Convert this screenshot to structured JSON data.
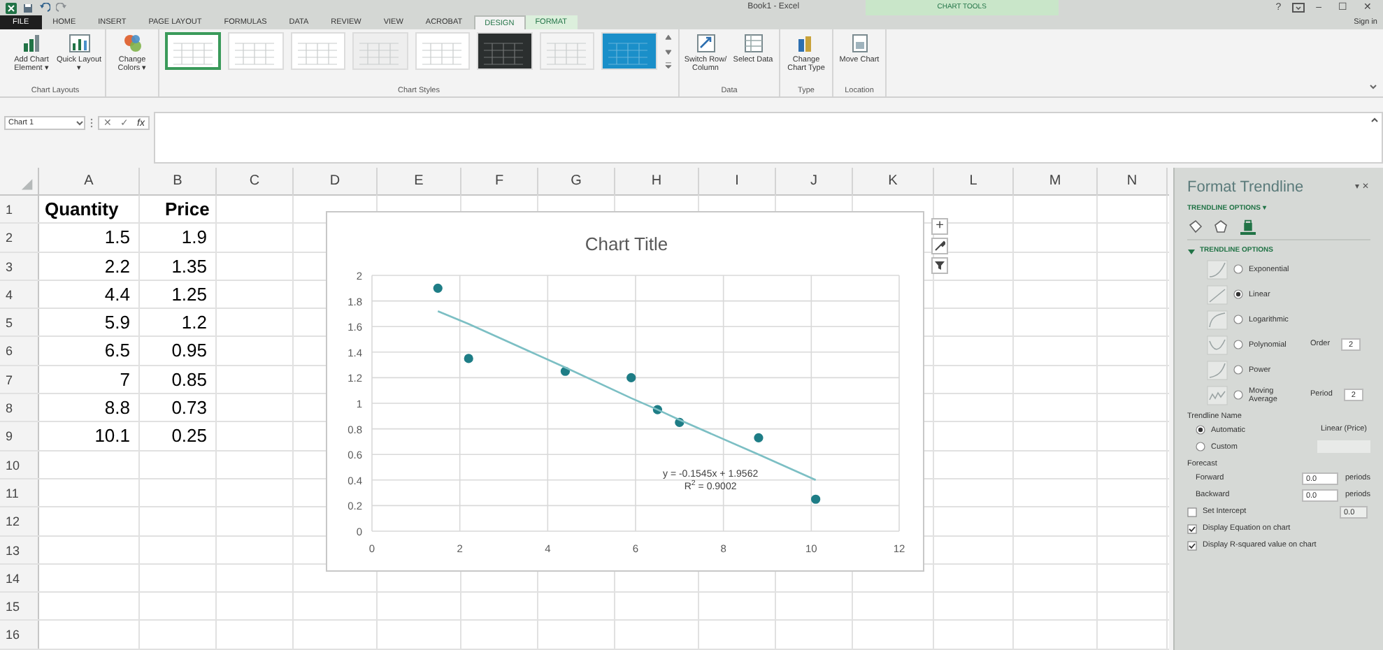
{
  "title_bar": {
    "title": "Book1 - Excel",
    "controls": [
      "?",
      "–",
      "☐",
      "✕"
    ]
  },
  "ribbon_tabs": [
    {
      "label": "FILE",
      "kind": "file",
      "selected": false
    },
    {
      "label": "HOME",
      "kind": "tab",
      "selected": false
    },
    {
      "label": "INSERT",
      "kind": "tab",
      "selected": false
    },
    {
      "label": "PAGE LAYOUT",
      "kind": "tab",
      "selected": false
    },
    {
      "label": "FORMULAS",
      "kind": "tab",
      "selected": false
    },
    {
      "label": "DATA",
      "kind": "tab",
      "selected": false
    },
    {
      "label": "REVIEW",
      "kind": "tab",
      "selected": false
    },
    {
      "label": "VIEW",
      "kind": "tab",
      "selected": false
    },
    {
      "label": "ACROBAT",
      "kind": "tab",
      "selected": false
    },
    {
      "label": "DESIGN",
      "kind": "contextual",
      "selected": true
    },
    {
      "label": "FORMAT",
      "kind": "contextual",
      "selected": false
    }
  ],
  "contextual_group": "CHART TOOLS",
  "sign_in": "Sign in",
  "ribbon_groups": [
    {
      "label": "Chart Layouts",
      "buttons": [
        "Add Chart Element ▾",
        "Quick Layout ▾"
      ]
    },
    {
      "buttons": [
        "Change Colors ▾"
      ]
    },
    {
      "label": "Chart Styles",
      "kind": "gallery"
    },
    {
      "label": "Data",
      "buttons": [
        "Switch Row/ Column",
        "Select Data"
      ]
    },
    {
      "label": "Type",
      "buttons": [
        "Change Chart Type"
      ]
    },
    {
      "label": "Location",
      "buttons": [
        "Move Chart"
      ]
    }
  ],
  "chart_styles": [
    {
      "color": "#ffffff",
      "selected": true
    },
    {
      "color": "#ffffff",
      "selected": false
    },
    {
      "color": "#ffffff",
      "selected": false
    },
    {
      "color": "#eeeeee",
      "selected": false
    },
    {
      "color": "#ffffff",
      "selected": false
    },
    {
      "color": "#2b2f2f",
      "selected": false
    },
    {
      "color": "#f4f4f4",
      "selected": false
    },
    {
      "color": "#1a8fc9",
      "selected": false
    }
  ],
  "formula_bar": {
    "name_box": "Chart 1",
    "buttons": [
      "✕",
      "✓",
      "fx"
    ]
  },
  "columns": [
    "A",
    "B",
    "C",
    "D",
    "E",
    "F",
    "G",
    "H",
    "I",
    "J",
    "K",
    "L",
    "M",
    "N"
  ],
  "rows": [
    {
      "header": "1",
      "kind": "heading",
      "cells": [
        "Quantity",
        "Price"
      ]
    },
    {
      "header": "2",
      "kind": "data",
      "cells": [
        "1.5",
        "1.9"
      ]
    },
    {
      "header": "3",
      "kind": "data",
      "cells": [
        "2.2",
        "1.35"
      ]
    },
    {
      "header": "4",
      "kind": "data",
      "cells": [
        "4.4",
        "1.25"
      ]
    },
    {
      "header": "5",
      "kind": "data",
      "cells": [
        "5.9",
        "1.2"
      ]
    },
    {
      "header": "6",
      "kind": "data",
      "cells": [
        "6.5",
        "0.95"
      ]
    },
    {
      "header": "7",
      "kind": "data",
      "cells": [
        "7",
        "0.85"
      ]
    },
    {
      "header": "8",
      "kind": "data",
      "cells": [
        "8.8",
        "0.73"
      ]
    },
    {
      "header": "9",
      "kind": "data",
      "cells": [
        "10.1",
        "0.25"
      ]
    },
    {
      "header": "10"
    },
    {
      "header": "11"
    },
    {
      "header": "12"
    },
    {
      "header": "13"
    },
    {
      "header": "14"
    },
    {
      "header": "15"
    },
    {
      "header": "16"
    }
  ],
  "chart": {
    "chart_data": {
      "type": "scatter",
      "title": "Chart Title",
      "x": [
        1.5,
        2.2,
        4.4,
        5.9,
        6.5,
        7,
        8.8,
        10.1
      ],
      "series": [
        {
          "color": "#1e7d86",
          "values": [
            1.9,
            1.35,
            1.25,
            1.2,
            0.95,
            0.85,
            0.73,
            0.25
          ]
        },
        {
          "type": "line",
          "color": "#7cbfc4",
          "values": [
            1.72,
            1.62,
            1.28,
            1.04,
            0.95,
            0.87,
            0.6,
            0.4
          ]
        }
      ],
      "grid": true,
      "xlim": [
        0,
        12
      ],
      "ylim": [
        0,
        2
      ],
      "xticks": [
        0,
        2,
        4,
        6,
        8,
        10,
        12
      ],
      "yticks": [
        0,
        0.2,
        0.4,
        0.6,
        0.8,
        1,
        1.2,
        1.4,
        1.6,
        1.8,
        2
      ],
      "annotations": [
        {
          "text": "y = -0.1545x + 1.9562"
        },
        {
          "text": "R$^{2}$ = 0.9002"
        }
      ]
    },
    "side_buttons": [
      "+"
    ]
  },
  "pane": {
    "title": "Format Trendline",
    "header_controls": [
      "▾",
      "✕"
    ],
    "options_dropdown": "TRENDLINE OPTIONS ▾",
    "icon_tabs": [
      {
        "kind": "fill",
        "selected": false
      },
      {
        "kind": "effects",
        "selected": false
      },
      {
        "kind": "options",
        "selected": true
      }
    ],
    "section": {
      "label": "TRENDLINE OPTIONS",
      "expanded": true
    },
    "types": [
      {
        "label": "Exponential",
        "selected": false
      },
      {
        "label": "Linear",
        "selected": true
      },
      {
        "label": "Logarithmic",
        "selected": false
      },
      {
        "label": "Polynomial",
        "selected": false,
        "param_label": "Order",
        "param_value": "2"
      },
      {
        "label": "Power",
        "selected": false
      },
      {
        "label": "Moving Average",
        "selected": false,
        "param_label": "Period",
        "param_value": "2"
      }
    ],
    "name_label": "Trendline Name",
    "name_options": [
      {
        "label": "Automatic",
        "selected": true,
        "value": "Linear (Price)"
      },
      {
        "label": "Custom",
        "selected": false
      }
    ],
    "forecast_label": "Forecast",
    "forecast": [
      {
        "label": "Forward",
        "value": "0.0",
        "unit": "periods"
      },
      {
        "label": "Backward",
        "value": "0.0",
        "unit": "periods"
      }
    ],
    "intercept": {
      "label": "Set Intercept",
      "checked": false,
      "value": "0.0"
    },
    "display": [
      {
        "label": "Display Equation on chart",
        "checked": true
      },
      {
        "label": "Display R-squared value on chart",
        "checked": true
      }
    ]
  }
}
